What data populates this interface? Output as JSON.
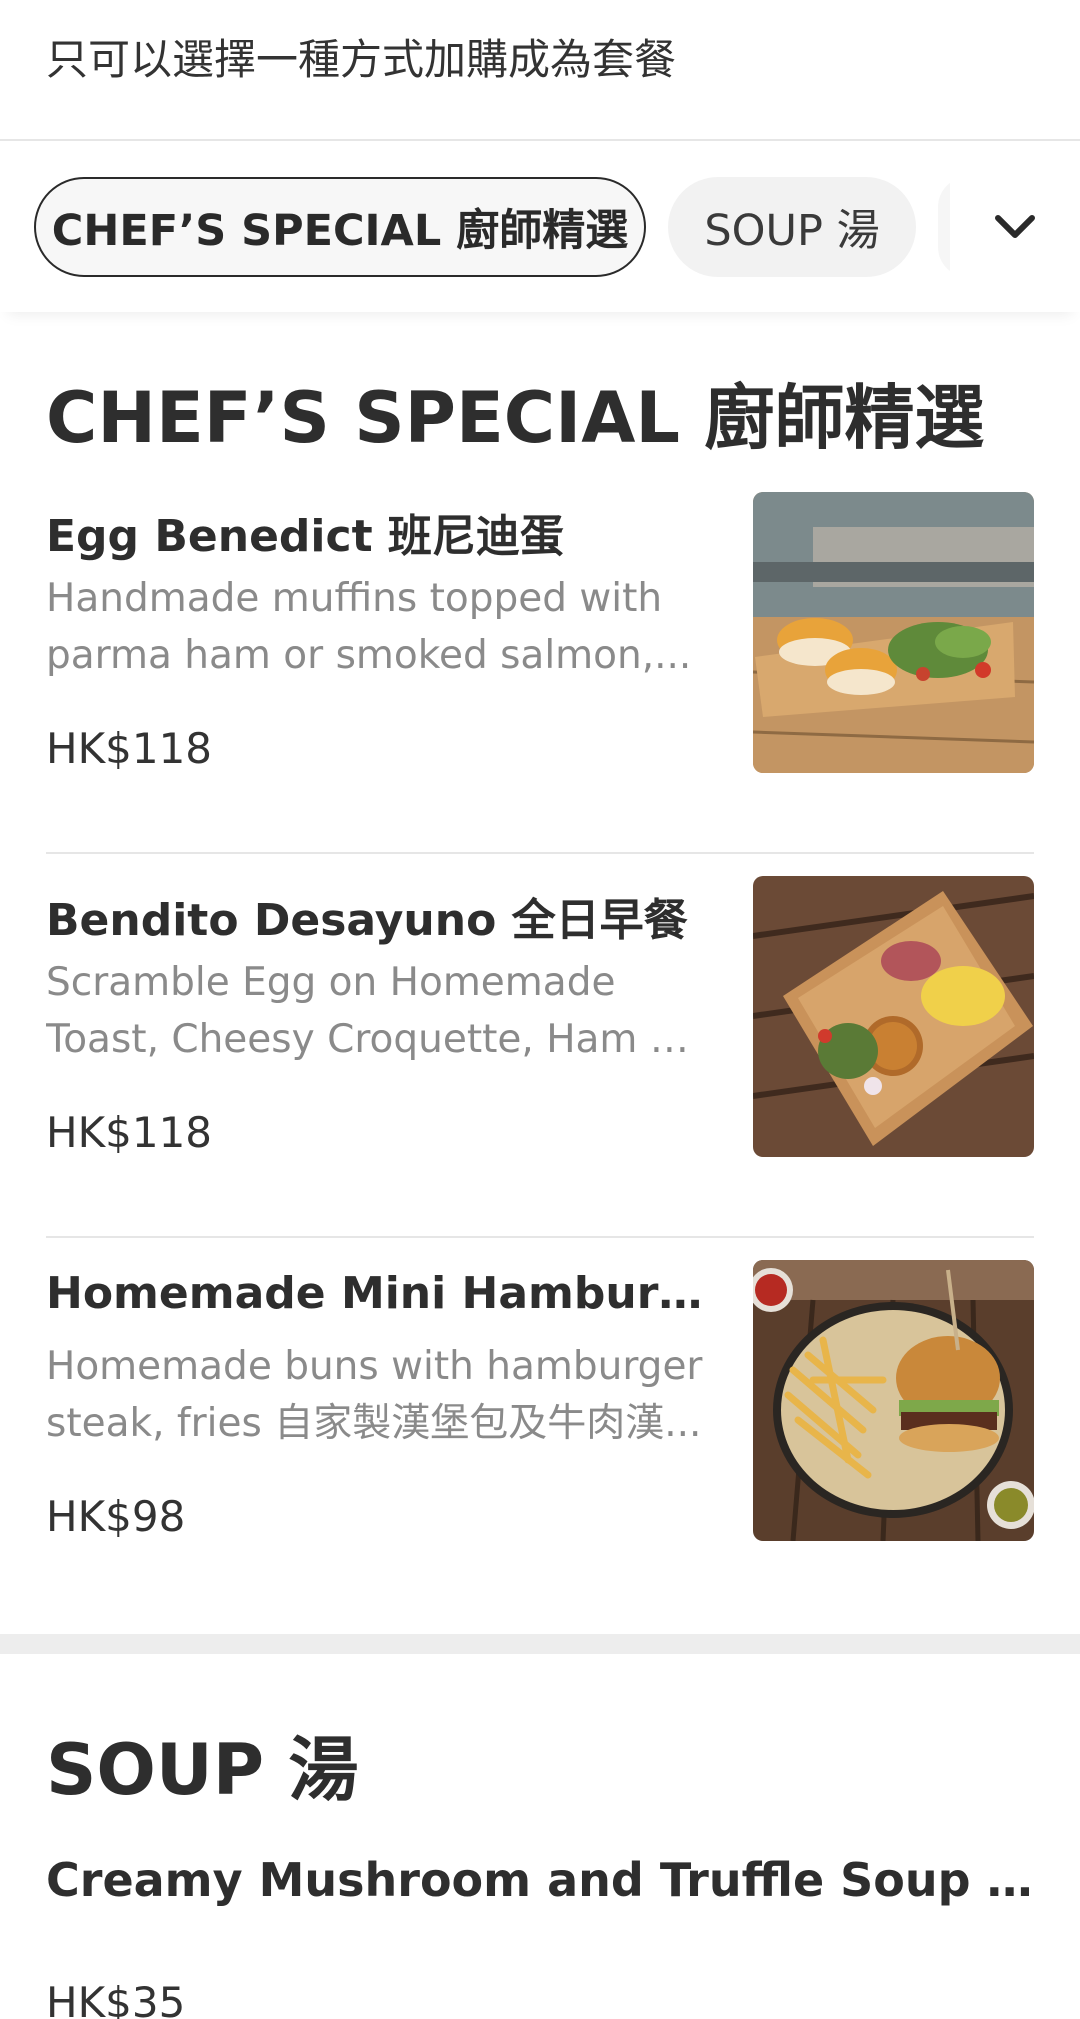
{
  "notice": "只可以選擇一種方式加購成為套餐",
  "tabs": [
    {
      "label": "CHEF’S SPECIAL 廚師精選",
      "active": true
    },
    {
      "label": "SOUP 湯",
      "active": false
    }
  ],
  "expand_icon": "chevron-down-icon",
  "sections": [
    {
      "title": "CHEF’S SPECIAL 廚師精選",
      "items": [
        {
          "name": "Egg Benedict 班尼迪蛋",
          "description": "Handmade muffins topped with parma ham or smoked salmon,...",
          "price": "HK$118",
          "photo": "egg-benedict-photo"
        },
        {
          "name": "Bendito Desayuno 全日早餐",
          "description": "Scramble Egg on Homemade Toast, Cheesy Croquette, Ham & Melon,...",
          "price": "HK$118",
          "photo": "all-day-breakfast-photo"
        },
        {
          "name": "Homemade Mini Hamburge...",
          "description": "Homemade buns with hamburger steak, fries 自家製漢堡包及牛肉漢...",
          "price": "HK$98",
          "photo": "mini-hamburger-photo"
        }
      ]
    },
    {
      "title": "SOUP 湯",
      "items": [
        {
          "name": "Creamy Mushroom and Truffle Soup 黑松露...",
          "price": "HK$35"
        }
      ]
    }
  ]
}
